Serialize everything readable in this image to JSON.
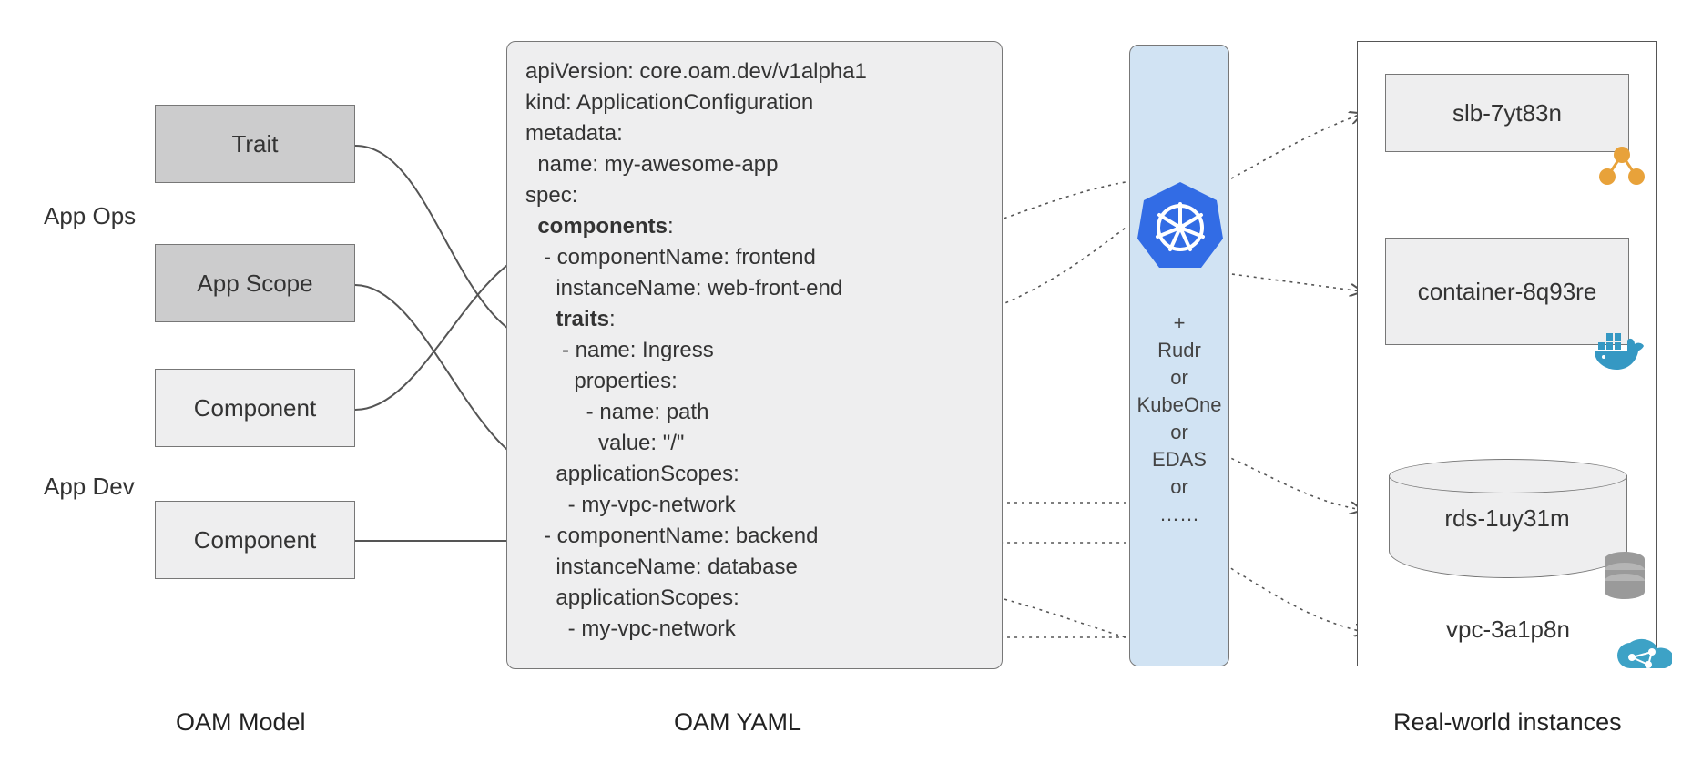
{
  "roles": {
    "app_ops": "App Ops",
    "app_dev": "App Dev"
  },
  "model_boxes": {
    "trait": "Trait",
    "app_scope": "App Scope",
    "component1": "Component",
    "component2": "Component"
  },
  "sections": {
    "model": "OAM Model",
    "yaml": "OAM YAML",
    "instances": "Real-world instances"
  },
  "yaml": {
    "l0": "apiVersion: core.oam.dev/v1alpha1",
    "l1": "kind: ApplicationConfiguration",
    "l2": "metadata:",
    "l3": "  name: my-awesome-app",
    "l4": "spec:",
    "l5_bold": "  components",
    "l5_tail": ":",
    "l6": "   - componentName: frontend",
    "l7": "     instanceName: web-front-end",
    "l8_pre": "     ",
    "l8_bold": "traits",
    "l8_tail": ":",
    "l9": "      - name: Ingress",
    "l10": "        properties:",
    "l11": "          - name: path",
    "l12": "            value: \"/\"",
    "l13": "     applicationScopes:",
    "l14": "       - my-vpc-network",
    "l15": "   - componentName: backend",
    "l16": "     instanceName: database",
    "l17": "     applicationScopes:",
    "l18": "       - my-vpc-network"
  },
  "runtime": {
    "plus": "+",
    "rudr": "Rudr",
    "or1": "or",
    "kubeone": "KubeOne",
    "or2": "or",
    "edas": "EDAS",
    "or3": "or",
    "dots": "……"
  },
  "instances": {
    "slb": "slb-7yt83n",
    "container": "container-8q93re",
    "rds": "rds-1uy31m",
    "vpc": "vpc-3a1p8n"
  },
  "icons": {
    "kubernetes": "kubernetes-logo-icon",
    "slb": "load-balancer-icon",
    "docker": "docker-whale-icon",
    "db": "database-stack-icon",
    "vpc": "cloud-network-icon"
  }
}
